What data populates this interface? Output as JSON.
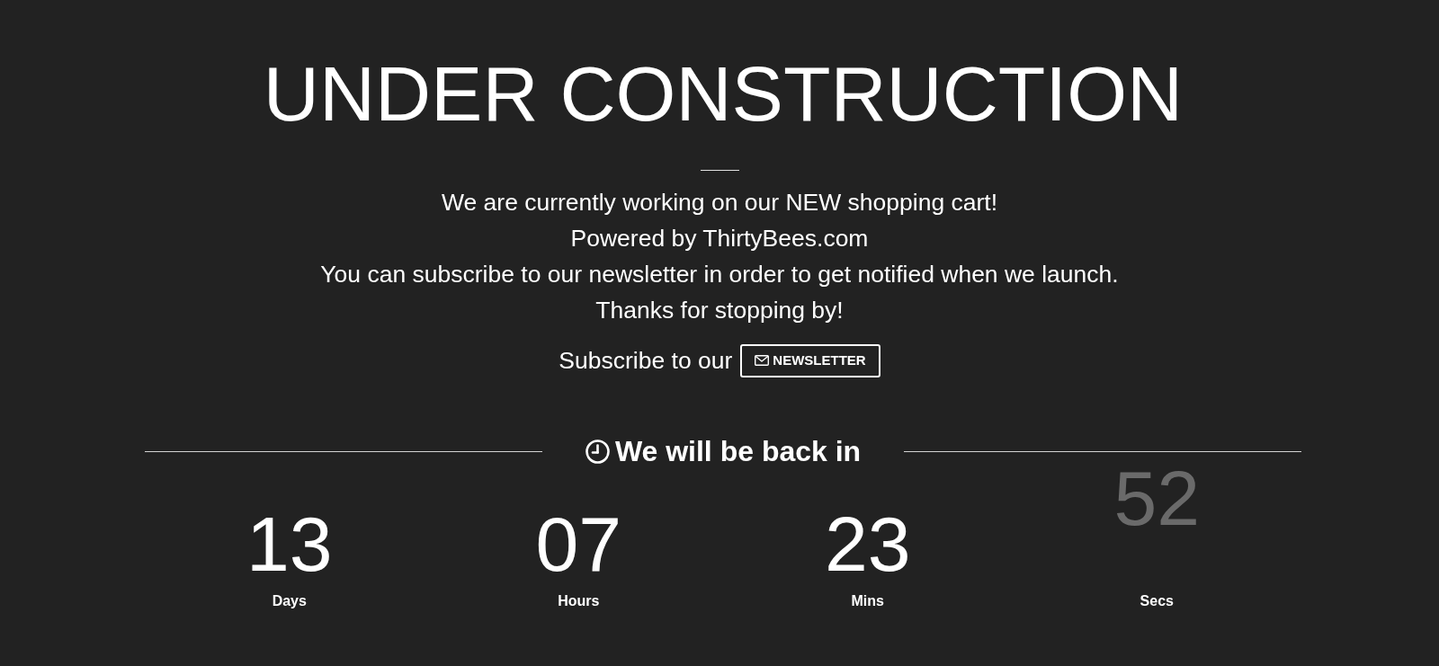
{
  "title": "UNDER CONSTRUCTION",
  "message_lines": [
    "We are currently working on our NEW shopping cart!",
    "Powered by ThirtyBees.com",
    "You can subscribe to our newsletter in order to get notified when we launch.",
    "Thanks for stopping by!"
  ],
  "subscribe": {
    "label": "Subscribe to our",
    "button": "NEWSLETTER"
  },
  "countdown": {
    "heading": "We will be back in",
    "units": [
      {
        "value": "13",
        "label": "Days",
        "dimmed": false
      },
      {
        "value": "07",
        "label": "Hours",
        "dimmed": false
      },
      {
        "value": "23",
        "label": "Mins",
        "dimmed": false
      },
      {
        "value": "52",
        "label": "Secs",
        "dimmed": true
      }
    ]
  }
}
